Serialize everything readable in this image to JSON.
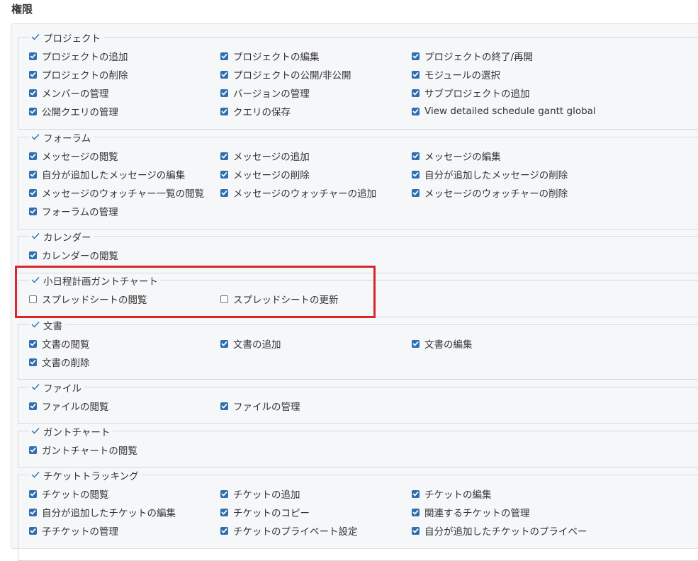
{
  "page": {
    "title": "権限"
  },
  "colors": {
    "checkbox_on": "#2f6fb1",
    "highlight": "#d8262b"
  },
  "groups": [
    {
      "legend": "プロジェクト",
      "items": [
        {
          "label": "プロジェクトの追加",
          "checked": true
        },
        {
          "label": "プロジェクトの編集",
          "checked": true
        },
        {
          "label": "プロジェクトの終了/再開",
          "checked": true
        },
        {
          "label": "プロジェクトの削除",
          "checked": true
        },
        {
          "label": "プロジェクトの公開/非公開",
          "checked": true
        },
        {
          "label": "モジュールの選択",
          "checked": true
        },
        {
          "label": "メンバーの管理",
          "checked": true
        },
        {
          "label": "バージョンの管理",
          "checked": true
        },
        {
          "label": "サブプロジェクトの追加",
          "checked": true
        },
        {
          "label": "公開クエリの管理",
          "checked": true
        },
        {
          "label": "クエリの保存",
          "checked": true
        },
        {
          "label": "View detailed schedule gantt global",
          "checked": true
        }
      ]
    },
    {
      "legend": "フォーラム",
      "items": [
        {
          "label": "メッセージの閲覧",
          "checked": true
        },
        {
          "label": "メッセージの追加",
          "checked": true
        },
        {
          "label": "メッセージの編集",
          "checked": true
        },
        {
          "label": "自分が追加したメッセージの編集",
          "checked": true
        },
        {
          "label": "メッセージの削除",
          "checked": true
        },
        {
          "label": "自分が追加したメッセージの削除",
          "checked": true
        },
        {
          "label": "メッセージのウォッチャー一覧の閲覧",
          "checked": true
        },
        {
          "label": "メッセージのウォッチャーの追加",
          "checked": true
        },
        {
          "label": "メッセージのウォッチャーの削除",
          "checked": true
        },
        {
          "label": "フォーラムの管理",
          "checked": true
        }
      ]
    },
    {
      "legend": "カレンダー",
      "items": [
        {
          "label": "カレンダーの閲覧",
          "checked": true
        }
      ]
    },
    {
      "legend": "小日程計画ガントチャート",
      "items": [
        {
          "label": "スプレッドシートの閲覧",
          "checked": false
        },
        {
          "label": "スプレッドシートの更新",
          "checked": false
        }
      ]
    },
    {
      "legend": "文書",
      "items": [
        {
          "label": "文書の閲覧",
          "checked": true
        },
        {
          "label": "文書の追加",
          "checked": true
        },
        {
          "label": "文書の編集",
          "checked": true
        },
        {
          "label": "文書の削除",
          "checked": true
        }
      ]
    },
    {
      "legend": "ファイル",
      "items": [
        {
          "label": "ファイルの閲覧",
          "checked": true
        },
        {
          "label": "ファイルの管理",
          "checked": true
        }
      ]
    },
    {
      "legend": "ガントチャート",
      "items": [
        {
          "label": "ガントチャートの閲覧",
          "checked": true
        }
      ]
    },
    {
      "legend": "チケットトラッキング",
      "items": [
        {
          "label": "チケットの閲覧",
          "checked": true
        },
        {
          "label": "チケットの追加",
          "checked": true
        },
        {
          "label": "チケットの編集",
          "checked": true
        },
        {
          "label": "自分が追加したチケットの編集",
          "checked": true
        },
        {
          "label": "チケットのコピー",
          "checked": true
        },
        {
          "label": "関連するチケットの管理",
          "checked": true
        },
        {
          "label": "子チケットの管理",
          "checked": true
        },
        {
          "label": "チケットのプライベート設定",
          "checked": true
        },
        {
          "label": "自分が追加したチケットのプライベー",
          "checked": true
        }
      ]
    }
  ]
}
